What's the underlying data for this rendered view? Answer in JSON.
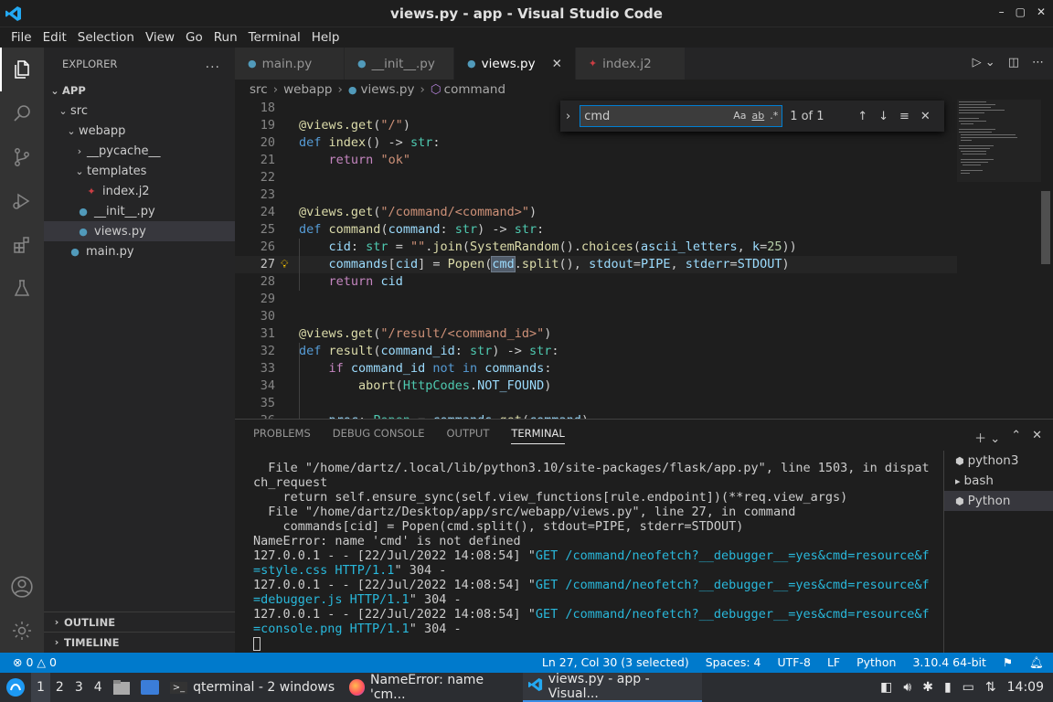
{
  "window": {
    "title": "views.py - app - Visual Studio Code",
    "min": "–",
    "max": "▢",
    "close": "✕"
  },
  "menu": [
    "File",
    "Edit",
    "Selection",
    "View",
    "Go",
    "Run",
    "Terminal",
    "Help"
  ],
  "sidebar": {
    "header": "EXPLORER",
    "more": "...",
    "root": "APP",
    "items": [
      {
        "label": "src",
        "depth": 1,
        "kind": "folder-open"
      },
      {
        "label": "webapp",
        "depth": 2,
        "kind": "folder-open"
      },
      {
        "label": "__pycache__",
        "depth": 3,
        "kind": "folder-closed"
      },
      {
        "label": "templates",
        "depth": 3,
        "kind": "folder-open"
      },
      {
        "label": "index.j2",
        "depth": 4,
        "kind": "jinja"
      },
      {
        "label": "__init__.py",
        "depth": 3,
        "kind": "python"
      },
      {
        "label": "views.py",
        "depth": 3,
        "kind": "python",
        "selected": true
      },
      {
        "label": "main.py",
        "depth": 2,
        "kind": "python"
      }
    ],
    "outline": "OUTLINE",
    "timeline": "TIMELINE"
  },
  "tabs": [
    {
      "label": "main.py",
      "kind": "python",
      "active": false
    },
    {
      "label": "__init__.py",
      "kind": "python",
      "active": false
    },
    {
      "label": "views.py",
      "kind": "python",
      "active": true
    },
    {
      "label": "index.j2",
      "kind": "jinja",
      "active": false
    }
  ],
  "breadcrumb": [
    "src",
    "webapp",
    "views.py",
    "command"
  ],
  "find": {
    "value": "cmd",
    "count": "1 of 1",
    "opt_case": "Aa",
    "opt_word": "ab",
    "opt_regex": ".*"
  },
  "code": {
    "first_line": 18,
    "current_line": 27,
    "lines": [
      {
        "n": "18",
        "t": ""
      },
      {
        "n": "19",
        "t": "@views.get(\"/\")"
      },
      {
        "n": "20",
        "t": "def index() -> str:"
      },
      {
        "n": "21",
        "t": "    return \"ok\""
      },
      {
        "n": "22",
        "t": ""
      },
      {
        "n": "23",
        "t": ""
      },
      {
        "n": "24",
        "t": "@views.get(\"/command/<command>\")"
      },
      {
        "n": "25",
        "t": "def command(command: str) -> str:"
      },
      {
        "n": "26",
        "t": "    cid: str = \"\".join(SystemRandom().choices(ascii_letters, k=25))"
      },
      {
        "n": "27",
        "t": "    commands[cid] = Popen(cmd.split(), stdout=PIPE, stderr=STDOUT)"
      },
      {
        "n": "28",
        "t": "    return cid"
      },
      {
        "n": "29",
        "t": ""
      },
      {
        "n": "30",
        "t": ""
      },
      {
        "n": "31",
        "t": "@views.get(\"/result/<command_id>\")"
      },
      {
        "n": "32",
        "t": "def result(command_id: str) -> str:"
      },
      {
        "n": "33",
        "t": "    if command_id not in commands:"
      },
      {
        "n": "34",
        "t": "        abort(HttpCodes.NOT_FOUND)"
      },
      {
        "n": "35",
        "t": ""
      },
      {
        "n": "36",
        "t": "    proc: Popen = commands.get(command)"
      }
    ]
  },
  "panel": {
    "tabs": [
      "PROBLEMS",
      "DEBUG CONSOLE",
      "OUTPUT",
      "TERMINAL"
    ],
    "active_tab": "TERMINAL",
    "terminal_lines": [
      [
        {
          "t": "  File \"/home/dartz/.local/lib/python3.10/site-packages/flask/app.py\", line 1503, in dispat"
        }
      ],
      [
        {
          "t": "ch_request"
        }
      ],
      [
        {
          "t": "    return self.ensure_sync(self.view_functions[rule.endpoint])(**req.view_args)"
        }
      ],
      [
        {
          "t": "  File \"/home/dartz/Desktop/app/src/webapp/views.py\", line 27, in command"
        }
      ],
      [
        {
          "t": "    commands[cid] = Popen(cmd.split(), stdout=PIPE, stderr=STDOUT)"
        }
      ],
      [
        {
          "t": "NameError: name 'cmd' is not defined"
        }
      ],
      [
        {
          "t": "127.0.0.1 - - [22/Jul/2022 14:08:54] \""
        },
        {
          "t": "GET /command/neofetch?__debugger__=yes&cmd=resource&f",
          "c": 1
        }
      ],
      [
        {
          "t": "=style.css HTTP/1.1",
          "c": 1
        },
        {
          "t": "\" 304 -"
        }
      ],
      [
        {
          "t": "127.0.0.1 - - [22/Jul/2022 14:08:54] \""
        },
        {
          "t": "GET /command/neofetch?__debugger__=yes&cmd=resource&f",
          "c": 1
        }
      ],
      [
        {
          "t": "=debugger.js HTTP/1.1",
          "c": 1
        },
        {
          "t": "\" 304 -"
        }
      ],
      [
        {
          "t": "127.0.0.1 - - [22/Jul/2022 14:08:54] \""
        },
        {
          "t": "GET /command/neofetch?__debugger__=yes&cmd=resource&f",
          "c": 1
        }
      ],
      [
        {
          "t": "=console.png HTTP/1.1",
          "c": 1
        },
        {
          "t": "\" 304 -"
        }
      ]
    ],
    "terminals": [
      {
        "label": "python3",
        "selected": false
      },
      {
        "label": "bash",
        "selected": false
      },
      {
        "label": "Python",
        "selected": true
      }
    ]
  },
  "status": {
    "errors": "0",
    "warnings": "0",
    "position": "Ln 27, Col 30 (3 selected)",
    "spaces": "Spaces: 4",
    "encoding": "UTF-8",
    "eol": "LF",
    "language": "Python",
    "interpreter": "3.10.4 64-bit"
  },
  "taskbar": {
    "workspaces": [
      "1",
      "2",
      "3",
      "4"
    ],
    "apps": [
      {
        "label": "qterminal - 2 windows",
        "icon": "terminal-icon"
      },
      {
        "label": "NameError: name 'cm...",
        "icon": "firefox-icon"
      },
      {
        "label": "views.py - app - Visual...",
        "icon": "vscode-icon",
        "active": true
      }
    ],
    "clock": "14:09"
  },
  "colors": {
    "accent": "#007acc",
    "activity": "#333333",
    "sidebar": "#252526",
    "editor": "#1e1e1e"
  }
}
